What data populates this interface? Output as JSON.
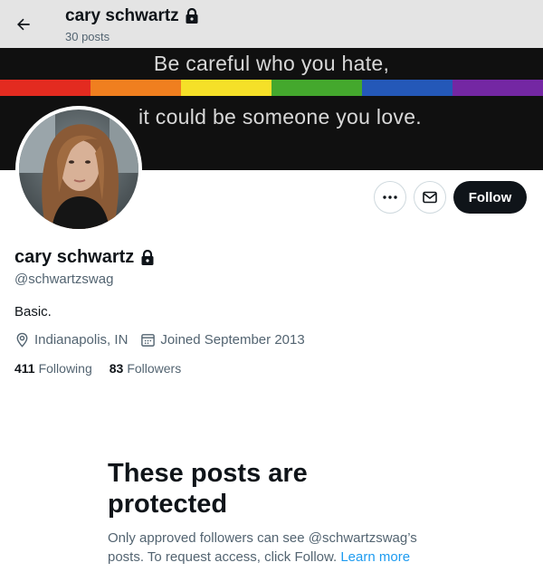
{
  "header": {
    "title": "cary schwartz",
    "post_count": "30 posts",
    "back_icon": "arrow-left-icon",
    "lock_icon": "lock-icon"
  },
  "banner": {
    "line1": "Be careful who you hate,",
    "line2": "it could be someone you love.",
    "rainbow_colors": [
      "#e32b20",
      "#f07f1f",
      "#f5e028",
      "#44a82d",
      "#2458b8",
      "#7427a3"
    ]
  },
  "profile": {
    "avatar_icon": "profile-photo",
    "display_name": "cary schwartz",
    "handle": "@schwartzswag",
    "bio": "Basic.",
    "location": "Indianapolis, IN",
    "joined": "Joined September 2013",
    "following_count": "411",
    "following_label": "Following",
    "followers_count": "83",
    "followers_label": "Followers"
  },
  "actions": {
    "more_icon": "more-dots-icon",
    "message_icon": "envelope-icon",
    "follow_label": "Follow"
  },
  "protected": {
    "title": "These posts are protected",
    "body": "Only approved followers can see @schwartzswag’s posts. To request access, click Follow.",
    "learn_more": "Learn more"
  },
  "colors": {
    "accent": "#1d9bf0",
    "text_primary": "#0f1419",
    "text_secondary": "#536471",
    "follow_button": "#0f1419"
  }
}
